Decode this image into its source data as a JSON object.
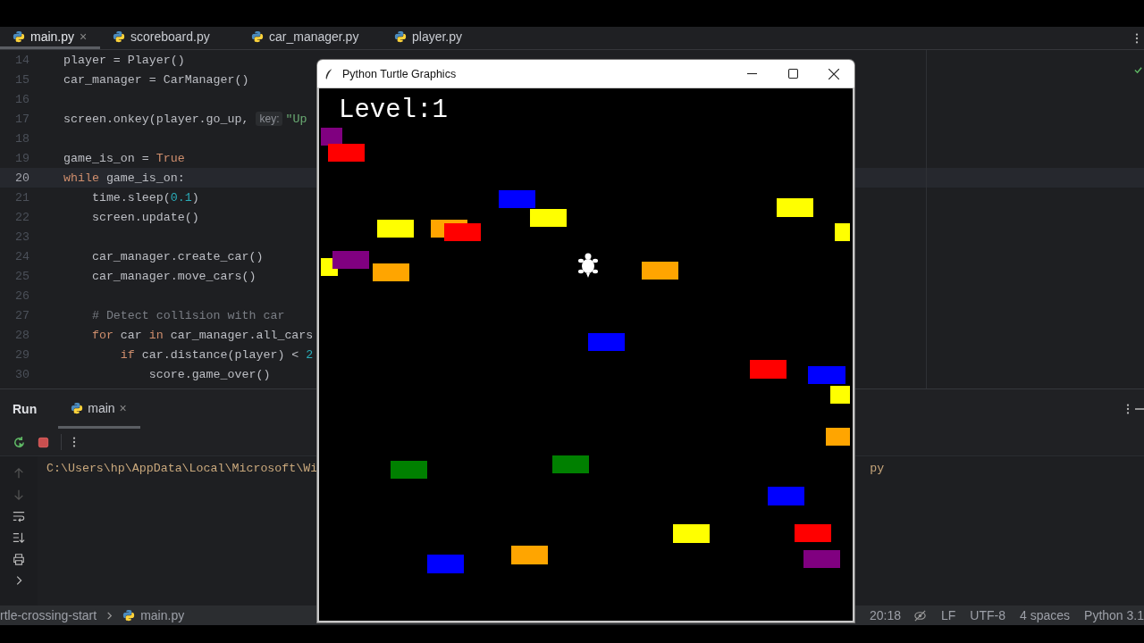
{
  "editor_tabs": [
    {
      "label": "main.py",
      "selected": true,
      "close": "×"
    },
    {
      "label": "scoreboard.py",
      "selected": false
    },
    {
      "label": "car_manager.py",
      "selected": false
    },
    {
      "label": "player.py",
      "selected": false
    }
  ],
  "code_lines": [
    {
      "number": "14",
      "current": false,
      "tokens": [
        {
          "kind": "plain",
          "text": "player = Player()"
        }
      ]
    },
    {
      "number": "15",
      "current": false,
      "tokens": [
        {
          "kind": "plain",
          "text": "car_manager = CarManager()"
        }
      ]
    },
    {
      "number": "16",
      "current": false
    },
    {
      "number": "17",
      "current": false,
      "tokens": [
        {
          "kind": "plain",
          "text": "screen.onkey(player.go_up, "
        },
        {
          "kind": "hint",
          "text": "key:"
        },
        {
          "kind": "string",
          "text": "\"Up"
        }
      ]
    },
    {
      "number": "18",
      "current": false
    },
    {
      "number": "19",
      "current": false,
      "tokens": [
        {
          "kind": "plain",
          "text": "game_is_on = "
        },
        {
          "kind": "keyword",
          "text": "True"
        }
      ]
    },
    {
      "number": "20",
      "current": true,
      "tokens": [
        {
          "kind": "keyword",
          "text": "while"
        },
        {
          "kind": "plain",
          "text": " game_is_on:"
        }
      ]
    },
    {
      "number": "21",
      "current": false,
      "tokens": [
        {
          "kind": "plain",
          "text": "    time.sleep("
        },
        {
          "kind": "number",
          "text": "0.1"
        },
        {
          "kind": "plain",
          "text": ")"
        }
      ]
    },
    {
      "number": "22",
      "current": false,
      "tokens": [
        {
          "kind": "plain",
          "text": "    screen.update()"
        }
      ]
    },
    {
      "number": "23",
      "current": false
    },
    {
      "number": "24",
      "current": false,
      "tokens": [
        {
          "kind": "plain",
          "text": "    car_manager.create_car()"
        }
      ]
    },
    {
      "number": "25",
      "current": false,
      "tokens": [
        {
          "kind": "plain",
          "text": "    car_manager.move_cars()"
        }
      ]
    },
    {
      "number": "26",
      "current": false
    },
    {
      "number": "27",
      "current": false,
      "tokens": [
        {
          "kind": "comment",
          "text": "    # Detect collision with car"
        }
      ]
    },
    {
      "number": "28",
      "current": false,
      "tokens": [
        {
          "kind": "keyword",
          "text": "    for"
        },
        {
          "kind": "plain",
          "text": " car "
        },
        {
          "kind": "keyword",
          "text": "in"
        },
        {
          "kind": "plain",
          "text": " car_manager.all_cars"
        }
      ]
    },
    {
      "number": "29",
      "current": false,
      "tokens": [
        {
          "kind": "keyword",
          "text": "        if"
        },
        {
          "kind": "plain",
          "text": " car.distance(player) < "
        },
        {
          "kind": "number",
          "text": "2"
        }
      ]
    },
    {
      "number": "30",
      "current": false,
      "tokens": [
        {
          "kind": "plain",
          "text": "            score.game_over()"
        }
      ]
    }
  ],
  "turtle_window": {
    "title": "Python Turtle Graphics",
    "level_text": "Level:1",
    "cars": [
      {
        "color": "#800080"
      },
      {
        "color": "#ff0000"
      },
      {
        "color": "#0000ff"
      },
      {
        "color": "#ffff00"
      },
      {
        "color": "#ffff00"
      },
      {
        "color": "#ffff00"
      },
      {
        "color": "#ffa500"
      },
      {
        "color": "#ff0000"
      },
      {
        "color": "#ffff00"
      },
      {
        "color": "#ffff00"
      },
      {
        "color": "#800080"
      },
      {
        "color": "#ffa500"
      },
      {
        "color": "#ffa500"
      },
      {
        "color": "#0000ff"
      },
      {
        "color": "#ff0000"
      },
      {
        "color": "#0000ff"
      },
      {
        "color": "#ffff00"
      },
      {
        "color": "#ffa500"
      },
      {
        "color": "#008000"
      },
      {
        "color": "#008000"
      },
      {
        "color": "#0000ff"
      },
      {
        "color": "#ffff00"
      },
      {
        "color": "#ff0000"
      },
      {
        "color": "#800080"
      },
      {
        "color": "#ffa500"
      },
      {
        "color": "#0000ff"
      }
    ]
  },
  "run_panel": {
    "title": "Run",
    "tabs": [
      {
        "label": "main",
        "selected": true,
        "close": "×"
      }
    ],
    "console_line": "C:\\Users\\hp\\AppData\\Local\\Microsoft\\Wi",
    "console_tail": "py"
  },
  "status_bar": {
    "breadcrumbs": [
      "rtle-crossing-start",
      "main.py"
    ],
    "items": [
      "20:18",
      "LF",
      "UTF-8",
      "4 spaces",
      "Python 3.1"
    ]
  }
}
